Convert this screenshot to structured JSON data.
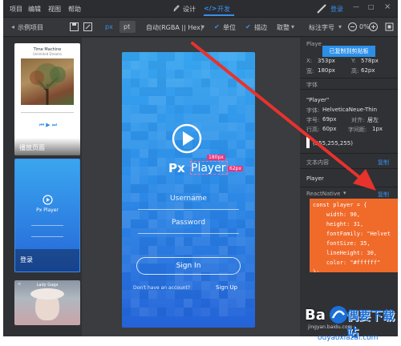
{
  "menubar": {
    "items": [
      "项目",
      "编辑",
      "视图",
      "帮助"
    ],
    "design_tab": "设计",
    "dev_tab": "开发",
    "login": "登录"
  },
  "toolbar": {
    "project_label": "示例项目",
    "unit_px": "px",
    "unit_pt": "pt",
    "color_format": "自动(RGBA || Hex)",
    "unit_check": "单位",
    "stroke_check": "描边",
    "round_label": "取整",
    "label_font": "标注字号",
    "zoom": "0%"
  },
  "left_panel": {
    "screens": [
      {
        "title": "播放页面",
        "header": "Time Machine",
        "subheader": "Unlimited Dreams"
      },
      {
        "title": "登录",
        "logo": "Px Player"
      },
      {
        "title": "Lady Gaga"
      }
    ]
  },
  "phone": {
    "logo_px": "Px",
    "logo_player": "Player",
    "username_placeholder": "Username",
    "password_placeholder": "Password",
    "signin": "Sign In",
    "no_account": "Don't have an account?",
    "signup": "Sign Up",
    "width_tag": "180px",
    "height_tag": "62px"
  },
  "right_panel": {
    "layer_name": "Playe",
    "copied_toast": "已复制到剪贴板",
    "x_label": "X:",
    "x_value": "353px",
    "y_label": "Y:",
    "y_value": "578px",
    "w_label": "宽:",
    "w_value": "180px",
    "h_label": "高:",
    "h_value": "62px",
    "font_section": "字体",
    "text_value": "\"Player\"",
    "font_label": "字体:",
    "font_value": "HelveticaNeue-Thin",
    "size_label": "字号:",
    "size_value": "69px",
    "align_label": "对齐:",
    "align_value": "居左",
    "lineheight_label": "行高:",
    "lineheight_value": "60px",
    "spacing_label": "字间距:",
    "spacing_value": "1px",
    "color_value": "(255,255,255)",
    "text_content_label": "文本内容",
    "copy1": "复制",
    "text_content_value": "Player",
    "react_native": "ReactNative",
    "copy2": "复制",
    "code_lines": [
      "const player = {",
      "    width: 90,",
      "    height: 31,",
      "    fontFamily: \"Helvet",
      "    fontSize: 35,",
      "    lineHeight: 30,",
      "    color: \"#ffffff\"",
      "};"
    ]
  },
  "watermark": {
    "brand": "偶要下载站",
    "brand_prefix": "Ba",
    "url": "ouyaoxiazai.com",
    "baidu": "jingyan.baidu.com"
  },
  "colors": {
    "accent": "#2b8fe8",
    "code_bg": "#f06a2a",
    "arrow": "#e8322c",
    "size_tag": "#e8337a"
  }
}
